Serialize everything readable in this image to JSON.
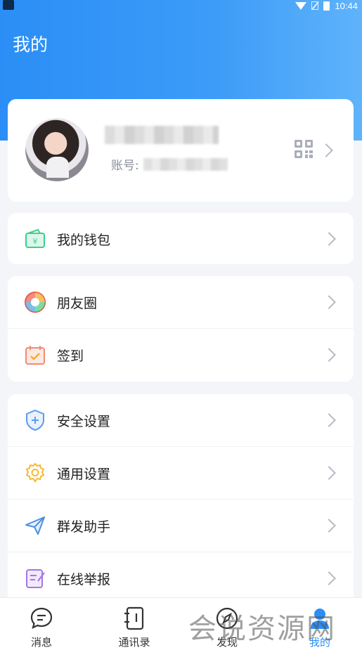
{
  "status_bar": {
    "time": "10:44"
  },
  "page": {
    "title": "我的"
  },
  "profile": {
    "account_label": "账号:"
  },
  "menu_groups": [
    {
      "items": [
        {
          "label": "我的钱包",
          "icon": "wallet-icon"
        }
      ]
    },
    {
      "items": [
        {
          "label": "朋友圈",
          "icon": "moments-icon"
        },
        {
          "label": "签到",
          "icon": "checkin-calendar-icon"
        }
      ]
    },
    {
      "items": [
        {
          "label": "安全设置",
          "icon": "shield-icon"
        },
        {
          "label": "通用设置",
          "icon": "gear-icon"
        },
        {
          "label": "群发助手",
          "icon": "paper-plane-icon"
        },
        {
          "label": "在线举报",
          "icon": "report-edit-icon"
        }
      ]
    }
  ],
  "tab_bar": {
    "tabs": [
      {
        "label": "消息",
        "icon": "chat-icon"
      },
      {
        "label": "通讯录",
        "icon": "contacts-book-icon"
      },
      {
        "label": "发现",
        "icon": "compass-icon"
      },
      {
        "label": "我的",
        "icon": "person-icon",
        "active": true
      }
    ]
  },
  "watermark": {
    "text": "会说资源网"
  },
  "colors": {
    "accent": "#2b8ef6",
    "header_gradient_end": "#5fb3fa",
    "background": "#f3f5f9"
  }
}
